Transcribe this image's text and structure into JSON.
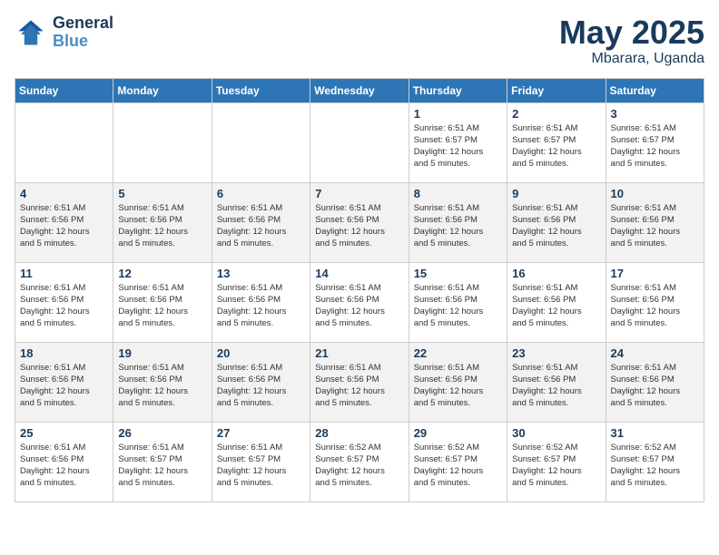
{
  "header": {
    "logo_line1": "General",
    "logo_line2": "Blue",
    "title": "May 2025",
    "subtitle": "Mbarara, Uganda"
  },
  "days_of_week": [
    "Sunday",
    "Monday",
    "Tuesday",
    "Wednesday",
    "Thursday",
    "Friday",
    "Saturday"
  ],
  "weeks": [
    [
      {
        "day": "",
        "info": ""
      },
      {
        "day": "",
        "info": ""
      },
      {
        "day": "",
        "info": ""
      },
      {
        "day": "",
        "info": ""
      },
      {
        "day": "1",
        "info": "Sunrise: 6:51 AM\nSunset: 6:57 PM\nDaylight: 12 hours\nand 5 minutes."
      },
      {
        "day": "2",
        "info": "Sunrise: 6:51 AM\nSunset: 6:57 PM\nDaylight: 12 hours\nand 5 minutes."
      },
      {
        "day": "3",
        "info": "Sunrise: 6:51 AM\nSunset: 6:57 PM\nDaylight: 12 hours\nand 5 minutes."
      }
    ],
    [
      {
        "day": "4",
        "info": "Sunrise: 6:51 AM\nSunset: 6:56 PM\nDaylight: 12 hours\nand 5 minutes."
      },
      {
        "day": "5",
        "info": "Sunrise: 6:51 AM\nSunset: 6:56 PM\nDaylight: 12 hours\nand 5 minutes."
      },
      {
        "day": "6",
        "info": "Sunrise: 6:51 AM\nSunset: 6:56 PM\nDaylight: 12 hours\nand 5 minutes."
      },
      {
        "day": "7",
        "info": "Sunrise: 6:51 AM\nSunset: 6:56 PM\nDaylight: 12 hours\nand 5 minutes."
      },
      {
        "day": "8",
        "info": "Sunrise: 6:51 AM\nSunset: 6:56 PM\nDaylight: 12 hours\nand 5 minutes."
      },
      {
        "day": "9",
        "info": "Sunrise: 6:51 AM\nSunset: 6:56 PM\nDaylight: 12 hours\nand 5 minutes."
      },
      {
        "day": "10",
        "info": "Sunrise: 6:51 AM\nSunset: 6:56 PM\nDaylight: 12 hours\nand 5 minutes."
      }
    ],
    [
      {
        "day": "11",
        "info": "Sunrise: 6:51 AM\nSunset: 6:56 PM\nDaylight: 12 hours\nand 5 minutes."
      },
      {
        "day": "12",
        "info": "Sunrise: 6:51 AM\nSunset: 6:56 PM\nDaylight: 12 hours\nand 5 minutes."
      },
      {
        "day": "13",
        "info": "Sunrise: 6:51 AM\nSunset: 6:56 PM\nDaylight: 12 hours\nand 5 minutes."
      },
      {
        "day": "14",
        "info": "Sunrise: 6:51 AM\nSunset: 6:56 PM\nDaylight: 12 hours\nand 5 minutes."
      },
      {
        "day": "15",
        "info": "Sunrise: 6:51 AM\nSunset: 6:56 PM\nDaylight: 12 hours\nand 5 minutes."
      },
      {
        "day": "16",
        "info": "Sunrise: 6:51 AM\nSunset: 6:56 PM\nDaylight: 12 hours\nand 5 minutes."
      },
      {
        "day": "17",
        "info": "Sunrise: 6:51 AM\nSunset: 6:56 PM\nDaylight: 12 hours\nand 5 minutes."
      }
    ],
    [
      {
        "day": "18",
        "info": "Sunrise: 6:51 AM\nSunset: 6:56 PM\nDaylight: 12 hours\nand 5 minutes."
      },
      {
        "day": "19",
        "info": "Sunrise: 6:51 AM\nSunset: 6:56 PM\nDaylight: 12 hours\nand 5 minutes."
      },
      {
        "day": "20",
        "info": "Sunrise: 6:51 AM\nSunset: 6:56 PM\nDaylight: 12 hours\nand 5 minutes."
      },
      {
        "day": "21",
        "info": "Sunrise: 6:51 AM\nSunset: 6:56 PM\nDaylight: 12 hours\nand 5 minutes."
      },
      {
        "day": "22",
        "info": "Sunrise: 6:51 AM\nSunset: 6:56 PM\nDaylight: 12 hours\nand 5 minutes."
      },
      {
        "day": "23",
        "info": "Sunrise: 6:51 AM\nSunset: 6:56 PM\nDaylight: 12 hours\nand 5 minutes."
      },
      {
        "day": "24",
        "info": "Sunrise: 6:51 AM\nSunset: 6:56 PM\nDaylight: 12 hours\nand 5 minutes."
      }
    ],
    [
      {
        "day": "25",
        "info": "Sunrise: 6:51 AM\nSunset: 6:56 PM\nDaylight: 12 hours\nand 5 minutes."
      },
      {
        "day": "26",
        "info": "Sunrise: 6:51 AM\nSunset: 6:57 PM\nDaylight: 12 hours\nand 5 minutes."
      },
      {
        "day": "27",
        "info": "Sunrise: 6:51 AM\nSunset: 6:57 PM\nDaylight: 12 hours\nand 5 minutes."
      },
      {
        "day": "28",
        "info": "Sunrise: 6:52 AM\nSunset: 6:57 PM\nDaylight: 12 hours\nand 5 minutes."
      },
      {
        "day": "29",
        "info": "Sunrise: 6:52 AM\nSunset: 6:57 PM\nDaylight: 12 hours\nand 5 minutes."
      },
      {
        "day": "30",
        "info": "Sunrise: 6:52 AM\nSunset: 6:57 PM\nDaylight: 12 hours\nand 5 minutes."
      },
      {
        "day": "31",
        "info": "Sunrise: 6:52 AM\nSunset: 6:57 PM\nDaylight: 12 hours\nand 5 minutes."
      }
    ]
  ]
}
